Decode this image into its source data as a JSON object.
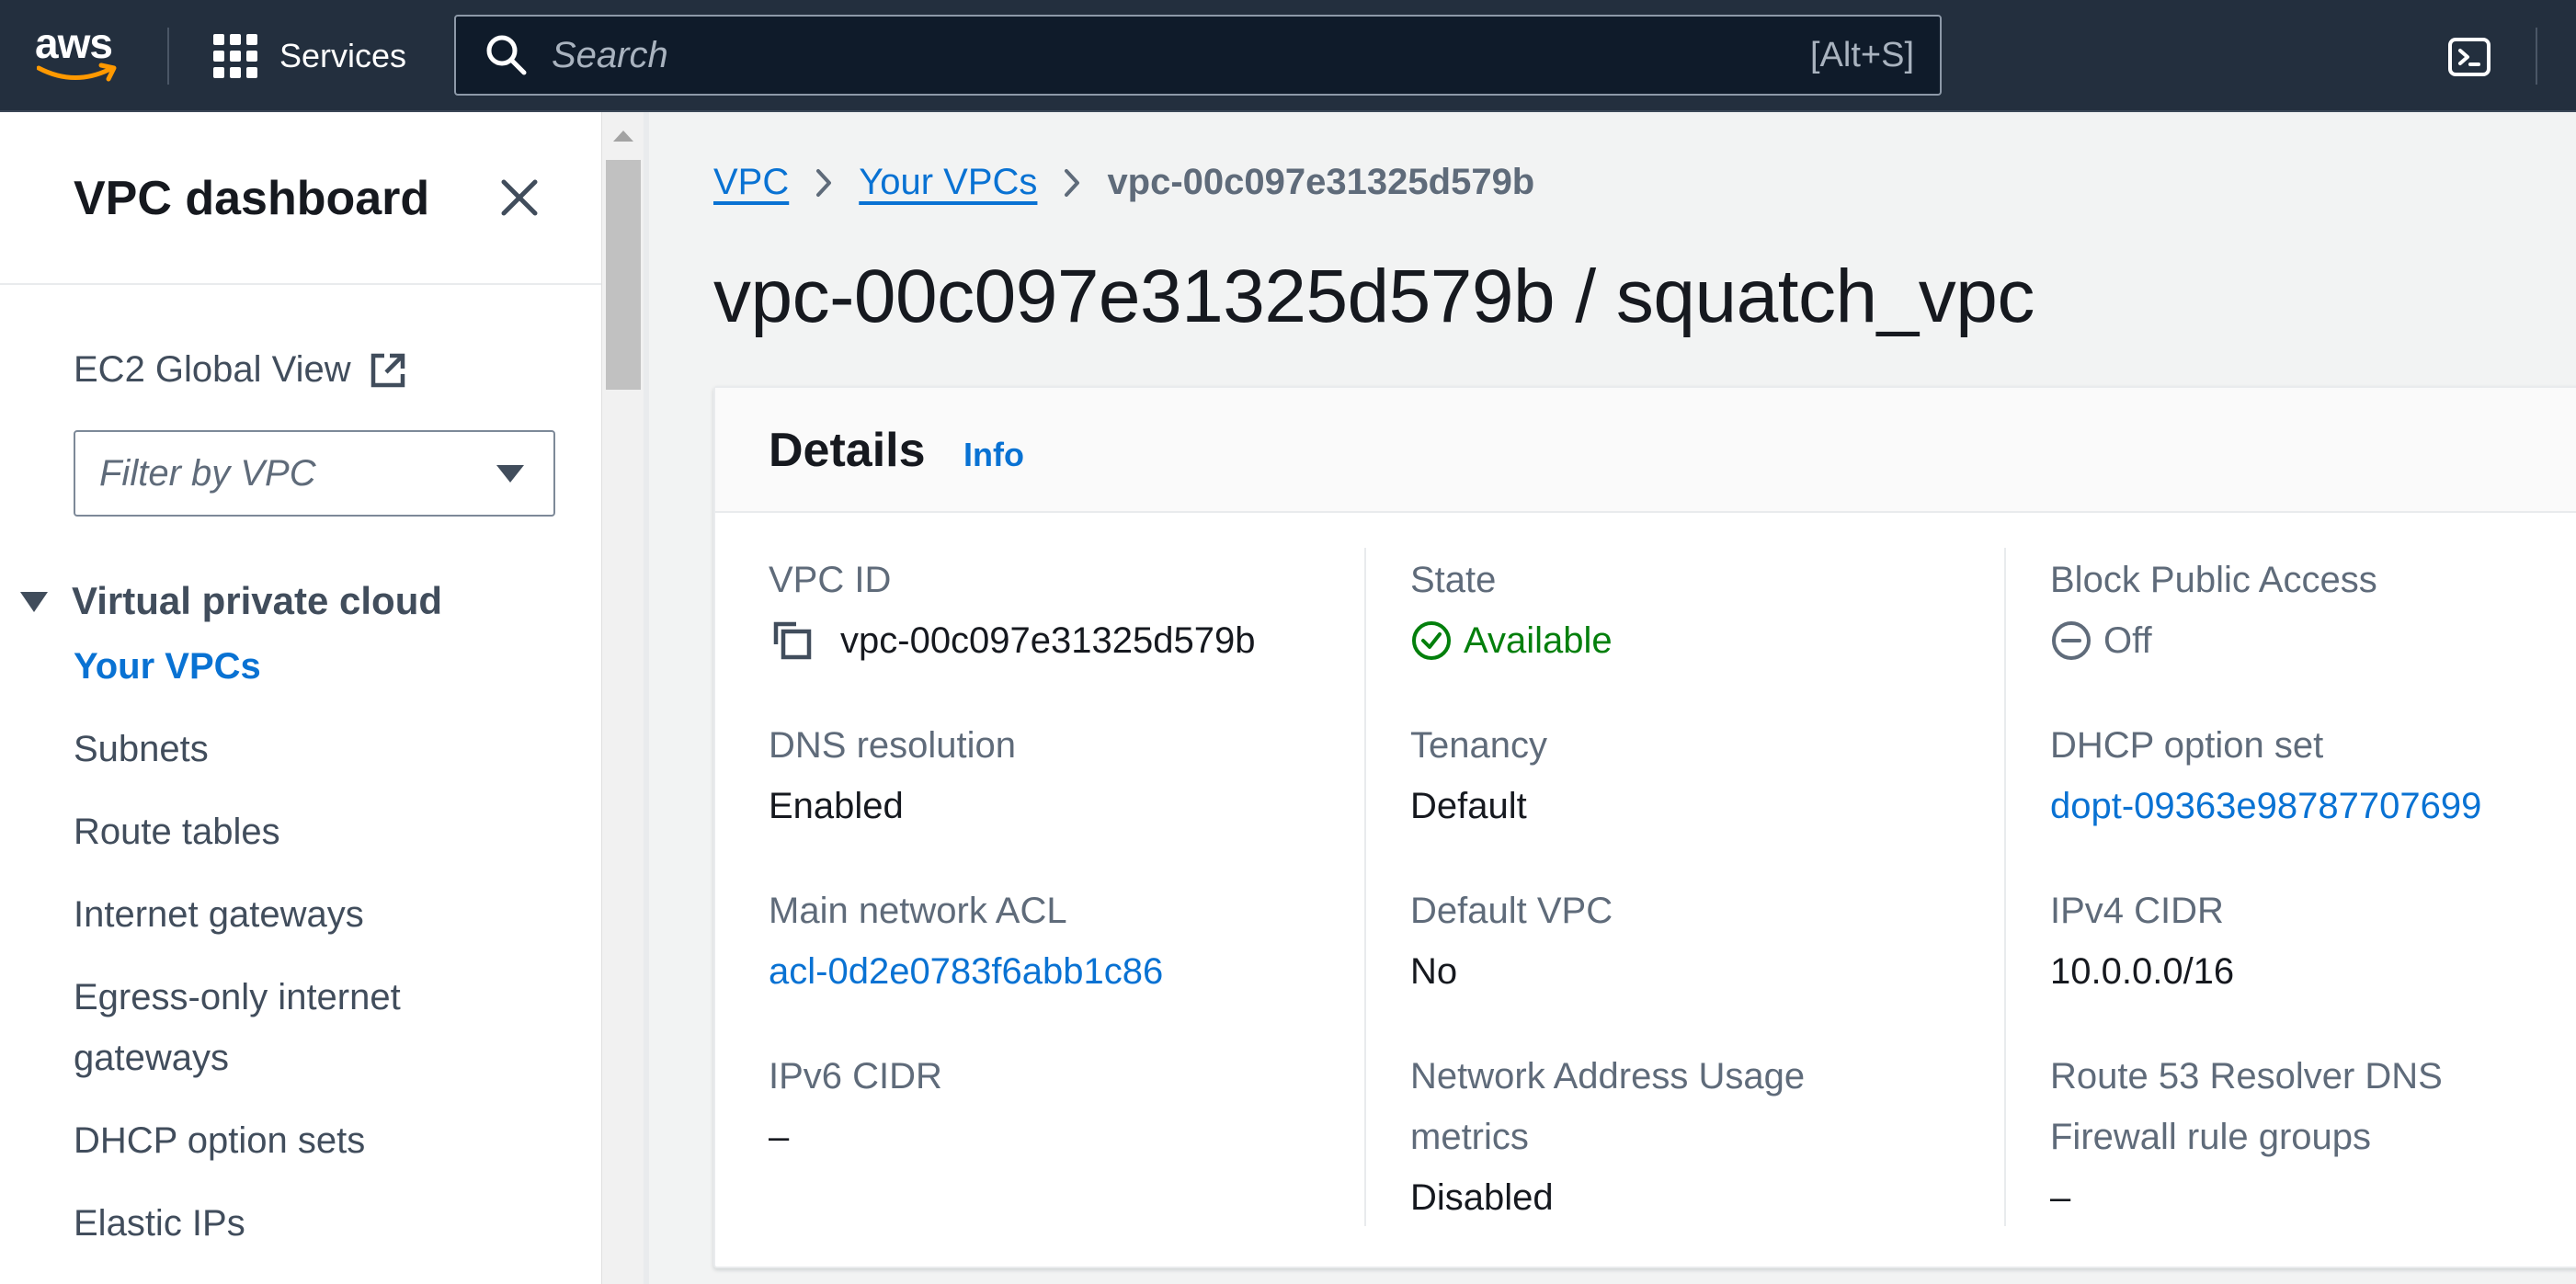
{
  "topnav": {
    "logo_text": "aws",
    "services_label": "Services",
    "search_placeholder": "Search",
    "search_shortcut": "[Alt+S]"
  },
  "sidenav": {
    "title": "VPC dashboard",
    "ec2_global_view": "EC2 Global View",
    "filter_placeholder": "Filter by VPC",
    "section_title": "Virtual private cloud",
    "items": [
      {
        "label": "Your VPCs",
        "active": true
      },
      {
        "label": "Subnets"
      },
      {
        "label": "Route tables"
      },
      {
        "label": "Internet gateways"
      },
      {
        "label": "Egress-only internet gateways"
      },
      {
        "label": "DHCP option sets"
      },
      {
        "label": "Elastic IPs"
      }
    ]
  },
  "breadcrumb": {
    "items": [
      "VPC",
      "Your VPCs"
    ],
    "current": "vpc-00c097e31325d579b"
  },
  "page_title": "vpc-00c097e31325d579b / squatch_vpc",
  "details": {
    "title": "Details",
    "info_label": "Info",
    "fields": {
      "vpc_id": {
        "label": "VPC ID",
        "value": "vpc-00c097e31325d579b"
      },
      "state": {
        "label": "State",
        "value": "Available"
      },
      "block_public_access": {
        "label": "Block Public Access",
        "value": "Off"
      },
      "dns_resolution": {
        "label": "DNS resolution",
        "value": "Enabled"
      },
      "tenancy": {
        "label": "Tenancy",
        "value": "Default"
      },
      "dhcp_option_set": {
        "label": "DHCP option set",
        "value": "dopt-09363e98787707699"
      },
      "main_network_acl": {
        "label": "Main network ACL",
        "value": "acl-0d2e0783f6abb1c86"
      },
      "default_vpc": {
        "label": "Default VPC",
        "value": "No"
      },
      "ipv4_cidr": {
        "label": "IPv4 CIDR",
        "value": "10.0.0.0/16"
      },
      "ipv6_cidr": {
        "label": "IPv6 CIDR",
        "value": "–"
      },
      "network_address_usage": {
        "label": "Network Address Usage metrics",
        "value": "Disabled"
      },
      "route53_resolver": {
        "label": "Route 53 Resolver DNS Firewall rule groups",
        "value": "–"
      }
    }
  },
  "colors": {
    "nav_bg": "#232f3e",
    "link": "#0972d3",
    "success": "#037f0c",
    "muted": "#5f6b7a"
  }
}
